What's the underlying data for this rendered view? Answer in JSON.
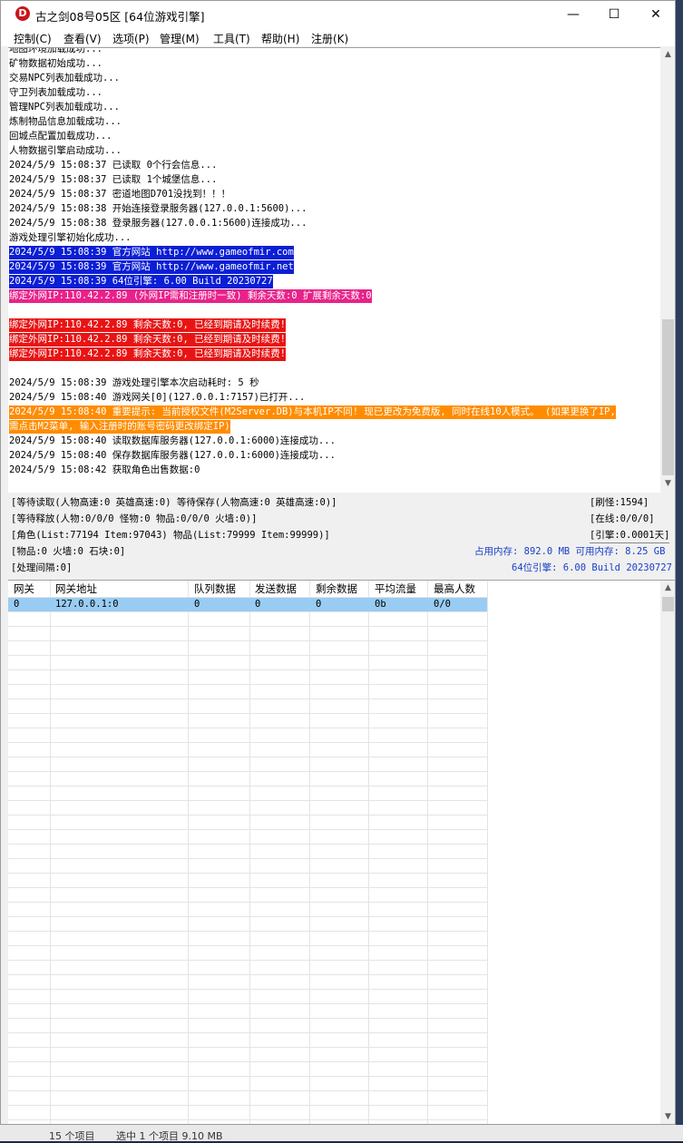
{
  "window": {
    "title": "古之剑08号05区 [64位游戏引擎]",
    "icon_letter": "D",
    "controls": {
      "minimize": "—",
      "maximize": "☐",
      "close": "✕"
    }
  },
  "menu": [
    "控制(C)",
    "查看(V)",
    "选项(P)",
    "管理(M)",
    "工具(T)",
    "帮助(H)",
    "注册(K)"
  ],
  "log_lines": [
    {
      "text": "地图环境加载成功...",
      "hl": ""
    },
    {
      "text": "矿物数据初始成功...",
      "hl": ""
    },
    {
      "text": "交易NPC列表加载成功...",
      "hl": ""
    },
    {
      "text": "守卫列表加载成功...",
      "hl": ""
    },
    {
      "text": "管理NPC列表加载成功...",
      "hl": ""
    },
    {
      "text": "炼制物品信息加载成功...",
      "hl": ""
    },
    {
      "text": "回城点配置加载成功...",
      "hl": ""
    },
    {
      "text": "人物数据引擎启动成功...",
      "hl": ""
    },
    {
      "text": "2024/5/9 15:08:37 已读取 0个行会信息...",
      "hl": ""
    },
    {
      "text": "2024/5/9 15:08:37 已读取 1个城堡信息...",
      "hl": ""
    },
    {
      "text": "2024/5/9 15:08:37 密道地图D701没找到！！！",
      "hl": ""
    },
    {
      "text": "2024/5/9 15:08:38 开始连接登录服务器(127.0.0.1:5600)...",
      "hl": ""
    },
    {
      "text": "2024/5/9 15:08:38 登录服务器(127.0.0.1:5600)连接成功...",
      "hl": ""
    },
    {
      "text": "游戏处理引擎初始化成功...",
      "hl": ""
    },
    {
      "text": "2024/5/9 15:08:39 官方网站 http://www.gameofmir.com",
      "hl": "blue"
    },
    {
      "text": "2024/5/9 15:08:39 官方网站 http://www.gameofmir.net",
      "hl": "blue"
    },
    {
      "text": "2024/5/9 15:08:39 64位引擎: 6.00 Build 20230727",
      "hl": "blue"
    },
    {
      "text": "绑定外网IP:110.42.2.89 (外网IP需和注册时一致) 剩余天数:0 扩展剩余天数:0",
      "hl": "pink"
    },
    {
      "text": "",
      "hl": ""
    },
    {
      "text": "绑定外网IP:110.42.2.89 剩余天数:0, 已经到期请及时续费!",
      "hl": "red"
    },
    {
      "text": "绑定外网IP:110.42.2.89 剩余天数:0, 已经到期请及时续费!",
      "hl": "red"
    },
    {
      "text": "绑定外网IP:110.42.2.89 剩余天数:0, 已经到期请及时续费!",
      "hl": "red"
    },
    {
      "text": "",
      "hl": ""
    },
    {
      "text": "2024/5/9 15:08:39 游戏处理引擎本次启动耗时: 5 秒",
      "hl": ""
    },
    {
      "text": "2024/5/9 15:08:40 游戏网关[0](127.0.0.1:7157)已打开...",
      "hl": ""
    },
    {
      "text": "2024/5/9 15:08:40 重要提示: 当前授权文件(M2Server.DB)与本机IP不同! 现已更改为免费版, 同时在线10人模式。 (如果更换了IP,",
      "hl": "orange"
    },
    {
      "text": "需点击M2菜单, 输入注册时的账号密码更改绑定IP)",
      "hl": "orange"
    },
    {
      "text": "2024/5/9 15:08:40 读取数据库服务器(127.0.0.1:6000)连接成功...",
      "hl": ""
    },
    {
      "text": "2024/5/9 15:08:40 保存数据库服务器(127.0.0.1:6000)连接成功...",
      "hl": ""
    },
    {
      "text": "2024/5/9 15:08:42 获取角色出售数据:0",
      "hl": ""
    }
  ],
  "status": {
    "wait_read": "[等待读取(人物高速:0 英雄高速:0) 等待保存(人物高速:0 英雄高速:0)]",
    "refresh_monster": "[刷怪:1594]",
    "wait_release": "[等待释放(人物:0/0/0 怪物:0 物品:0/0/0 火墙:0)]",
    "online": "[在线:0/0/0]",
    "role_list": "[角色(List:77194 Item:97043) 物品(List:79999 Item:99999)]",
    "engine": "[引擎:0.0001天]",
    "items_line": "[物品:0 火墙:0 石块:0]",
    "memory": "占用内存: 892.0 MB 可用内存: 8.25 GB",
    "interval": "[处理间隔:0]",
    "build": "64位引擎: 6.00 Build 20230727"
  },
  "gateway_table": {
    "headers": [
      "网关",
      "网关地址",
      "队列数据",
      "发送数据",
      "剩余数据",
      "平均流量",
      "最高人数"
    ],
    "rows": [
      [
        "0",
        "127.0.0.1:0",
        "0",
        "0",
        "0",
        "0b",
        "0/0"
      ]
    ]
  },
  "desktop_footer": {
    "items": "15 个项目",
    "selected": "选中 1 个项目 9.10 MB"
  },
  "colors": {
    "blue_highlight": "#0a1fd6",
    "pink_highlight": "#e8228a",
    "red_highlight": "#e81414",
    "orange_highlight": "#ff8c00",
    "selected_row": "#99ccf3"
  }
}
